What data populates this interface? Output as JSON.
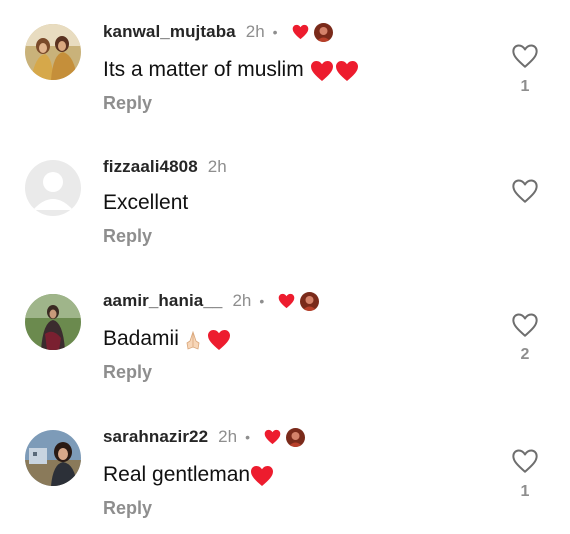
{
  "colors": {
    "heart": "#ed1c2e",
    "muted": "#8e8e8e",
    "text": "#111111"
  },
  "comments": [
    {
      "username": "kanwal_mujtaba",
      "time": "2h",
      "separator": "•",
      "text": "Its a matter of muslim",
      "text_emojis": [
        "red-heart-icon",
        "red-heart-icon"
      ],
      "creator_liked": true,
      "reply_label": "Reply",
      "like_icon": "heart-outline-icon",
      "like_count": "1"
    },
    {
      "username": "fizzaali4808",
      "time": "2h",
      "text": "Excellent",
      "creator_liked": false,
      "reply_label": "Reply",
      "like_icon": "heart-outline-icon",
      "like_count": ""
    },
    {
      "username": "aamir_hania__",
      "time": "2h",
      "separator": "•",
      "text": "Badamii",
      "text_emojis": [
        "folded-hands-icon",
        "red-heart-icon"
      ],
      "creator_liked": true,
      "reply_label": "Reply",
      "like_icon": "heart-outline-icon",
      "like_count": "2"
    },
    {
      "username": "sarahnazir22",
      "time": "2h",
      "separator": "•",
      "text": "Real gentleman",
      "text_emojis": [
        "red-heart-icon"
      ],
      "creator_liked": true,
      "reply_label": "Reply",
      "like_icon": "heart-outline-icon",
      "like_count": "1"
    }
  ]
}
